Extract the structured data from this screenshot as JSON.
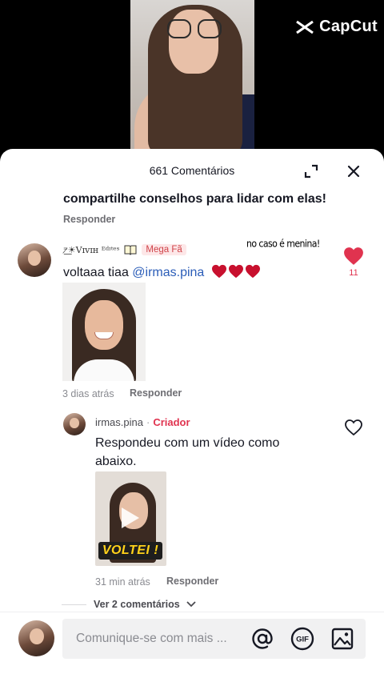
{
  "overlay": {
    "brand": "CapCut",
    "brand_icon": "capcut-logo-icon"
  },
  "header": {
    "title": "661 Comentários",
    "expand_icon": "expand-icon",
    "close_icon": "close-icon"
  },
  "previous_comment": {
    "text": "compartilhe conselhos para lidar com elas!",
    "reply_label": "Responder"
  },
  "comment": {
    "username": "⁼̷͟☀Vɪᴠɪʜ ᴱᵈᶦᵗᵉˢ",
    "badge": "Mega Fã",
    "overlay_note": "no caso é menina!",
    "text_prefix": "voltaaa tiaa ",
    "mention": "@irmas.pina",
    "like_count": "11",
    "liked": true,
    "timestamp": "3 dias atrás",
    "reply_label": "Responder"
  },
  "reply": {
    "username": "irmas.pina",
    "separator": "·",
    "role": "Criador",
    "text": "Respondeu com um vídeo como abaixo.",
    "thumbnail_caption": "VOLTEI !",
    "timestamp": "31 min atrás",
    "reply_label": "Responder",
    "liked": false
  },
  "more_replies": {
    "label": "Ver 2 comentários"
  },
  "composer": {
    "placeholder": "Comunique-se com mais ...",
    "icons": [
      "at-icon",
      "gif-icon",
      "image-icon"
    ],
    "gif_label": "GIF"
  },
  "colors": {
    "like_red": "#e0334f",
    "mention_blue": "#2b5db8",
    "creator_red": "#e0334f",
    "badge_bg": "#fde7e8"
  }
}
